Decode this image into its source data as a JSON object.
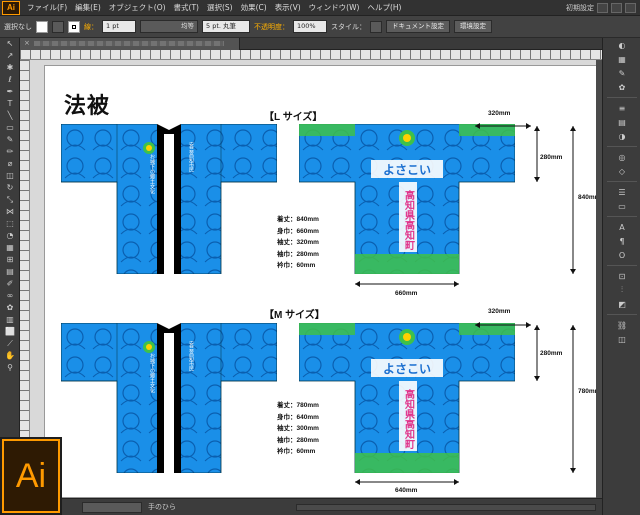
{
  "menubar": {
    "app_logo": "Ai",
    "items": [
      "ファイル(F)",
      "編集(E)",
      "オブジェクト(O)",
      "書式(T)",
      "選択(S)",
      "効果(C)",
      "表示(V)",
      "ウィンドウ(W)",
      "ヘルプ(H)"
    ],
    "workspace": "初期設定"
  },
  "control_bar": {
    "selection_label": "選択なし",
    "stroke_label": "線：",
    "stroke_weight": "1 pt",
    "stroke_style": "均等",
    "brush": "5 pt. 丸筆",
    "opacity_label": "不透明度：",
    "opacity_value": "100%",
    "style_label": "スタイル：",
    "doc_setup_button": "ドキュメント設定",
    "prefs_button": "環境設定"
  },
  "document": {
    "title": "法被",
    "large": {
      "heading": "【L サイズ】",
      "specs": [
        "着丈：840mm",
        "身巾：660mm",
        "袖丈：320mm",
        "袖巾：280mm",
        "衿巾：60mm"
      ],
      "dims": {
        "sleeve_length": "320mm",
        "sleeve_width": "280mm",
        "total_length": "840mm",
        "body_width": "660mm"
      }
    },
    "medium": {
      "heading": "【M サイズ】",
      "specs": [
        "着丈：780mm",
        "身巾：640mm",
        "袖丈：300mm",
        "袖巾：280mm",
        "衿巾：60mm"
      ],
      "dims": {
        "sleeve_length": "320mm",
        "sleeve_width": "280mm",
        "total_length": "780mm",
        "body_width": "640mm"
      }
    },
    "front_collar_text_left": "お城下の郷土文化",
    "front_collar_text_right": "安芸高知市民",
    "back_logo_text": "よさこい",
    "back_vertical_text": "高知県高知町"
  },
  "statusbar": {
    "tool_label": "手のひら"
  },
  "colors": {
    "happi_blue": "#1a8fe8",
    "happi_green": "#3ec14a",
    "accent_orange": "#ff9a00",
    "vertical_text_pink": "#e0338a"
  },
  "icons": {
    "close": "close-icon",
    "selection_tool": "arrow-icon"
  }
}
